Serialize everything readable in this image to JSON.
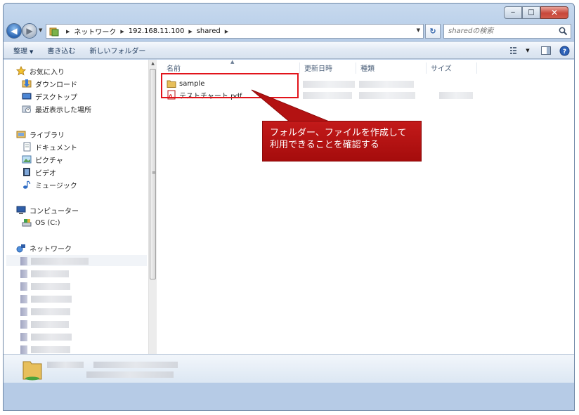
{
  "window": {
    "caption": {
      "minimize": "‒",
      "maximize": "□",
      "close": "✕"
    }
  },
  "address": {
    "crumbs": [
      "ネットワーク",
      "192.168.11.100",
      "shared"
    ]
  },
  "search": {
    "placeholder": "sharedの検索"
  },
  "toolbar": {
    "organize": "整理",
    "burn": "書き込む",
    "new_folder": "新しいフォルダー"
  },
  "nav": {
    "favorites": {
      "label": "お気に入り",
      "items": [
        "ダウンロード",
        "デスクトップ",
        "最近表示した場所"
      ]
    },
    "libraries": {
      "label": "ライブラリ",
      "items": [
        "ドキュメント",
        "ピクチャ",
        "ビデオ",
        "ミュージック"
      ]
    },
    "computer": {
      "label": "コンピューター",
      "items": [
        "OS (C:)"
      ]
    },
    "network": {
      "label": "ネットワーク"
    }
  },
  "columns": {
    "name": "名前",
    "modified": "更新日時",
    "type": "種類",
    "size": "サイズ"
  },
  "files": [
    {
      "name": "sample",
      "icon": "folder-icon"
    },
    {
      "name": "テストチャート.pdf",
      "icon": "pdf-icon"
    }
  ],
  "callout": {
    "line1": "フォルダー、ファイルを作成して",
    "line2": "利用できることを確認する"
  },
  "colors": {
    "callout": "#b31212",
    "highlight": "#e2141b",
    "chrome": "#b9cfe9"
  }
}
